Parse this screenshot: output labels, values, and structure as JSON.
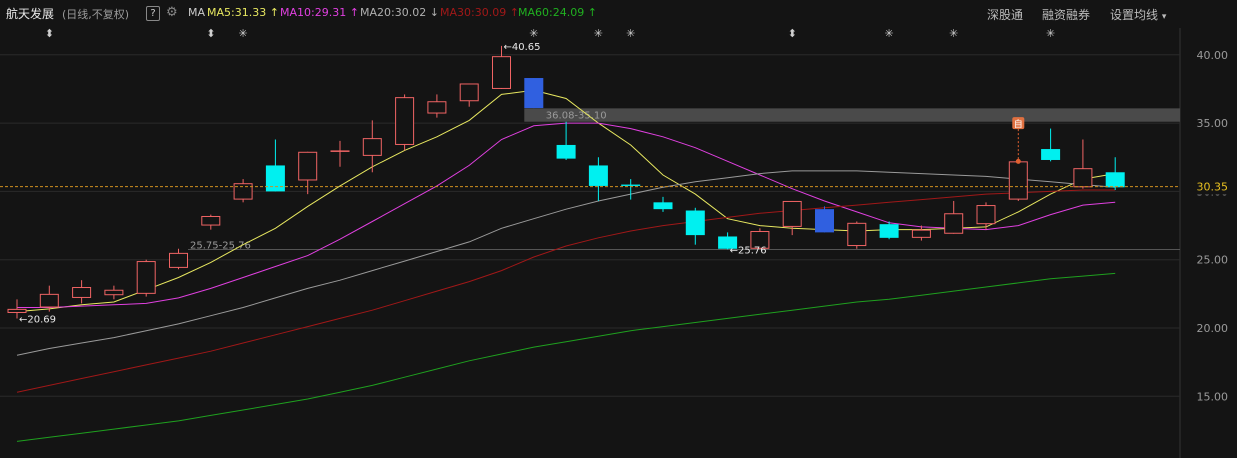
{
  "header": {
    "title": "航天发展",
    "period": "(日线,不复权)",
    "help": "?",
    "ma_label": "MA",
    "ma": [
      {
        "text": "MA5:31.33",
        "arrow": "↑",
        "color": "#e8e860"
      },
      {
        "text": "MA10:29.31",
        "arrow": "↑",
        "color": "#e040e0"
      },
      {
        "text": "MA20:30.02",
        "arrow": "↓",
        "color": "#b0b0b0"
      },
      {
        "text": "MA30:30.09",
        "arrow": "↑",
        "color": "#a01818"
      },
      {
        "text": "MA60:24.09",
        "arrow": "↑",
        "color": "#20b020"
      }
    ],
    "buttons": {
      "shengutong": "深股通",
      "rzrq": "融资融券",
      "set_ma": "设置均线"
    }
  },
  "chart_data": {
    "type": "candlestick",
    "y_ticks": [
      "40.00",
      "35.00",
      "30.00",
      "25.00",
      "20.00",
      "15.00"
    ],
    "ylim": [
      12.8,
      43.4
    ],
    "current_price": "30.35",
    "candles": [
      {
        "o": 21.1,
        "c": 21.4,
        "h": 22.1,
        "l": 20.7
      },
      {
        "o": 21.5,
        "c": 22.5,
        "h": 23.1,
        "l": 21.2
      },
      {
        "o": 22.2,
        "c": 23.0,
        "h": 23.5,
        "l": 21.8
      },
      {
        "o": 22.4,
        "c": 22.8,
        "h": 23.1,
        "l": 22.1
      },
      {
        "o": 22.5,
        "c": 24.9,
        "h": 25.0,
        "l": 22.3
      },
      {
        "o": 24.4,
        "c": 25.5,
        "h": 25.8,
        "l": 24.3
      },
      {
        "o": 27.5,
        "c": 28.2,
        "h": 28.3,
        "l": 27.2
      },
      {
        "o": 29.4,
        "c": 30.6,
        "h": 30.9,
        "l": 29.2
      },
      {
        "o": 31.9,
        "c": 30.0,
        "h": 33.8,
        "l": 30.0
      },
      {
        "o": 30.8,
        "c": 32.9,
        "h": 32.9,
        "l": 29.8
      },
      {
        "o": 32.9,
        "c": 33.0,
        "h": 33.7,
        "l": 31.8
      },
      {
        "o": 32.6,
        "c": 33.9,
        "h": 35.2,
        "l": 31.4
      },
      {
        "o": 33.4,
        "c": 36.9,
        "h": 37.1,
        "l": 33.0
      },
      {
        "o": 35.7,
        "c": 36.6,
        "h": 37.1,
        "l": 35.4
      },
      {
        "o": 36.6,
        "c": 37.9,
        "h": 37.9,
        "l": 36.2
      },
      {
        "o": 37.5,
        "c": 39.9,
        "h": 40.65,
        "l": 37.5
      },
      {
        "o": 38.3,
        "c": 36.1,
        "h": 38.3,
        "l": 36.1,
        "special": true
      },
      {
        "o": 33.4,
        "c": 32.4,
        "h": 35.1,
        "l": 32.3
      },
      {
        "o": 31.9,
        "c": 30.4,
        "h": 32.5,
        "l": 29.3
      },
      {
        "o": 30.5,
        "c": 30.4,
        "h": 30.9,
        "l": 29.4
      },
      {
        "o": 29.2,
        "c": 28.7,
        "h": 29.6,
        "l": 28.5
      },
      {
        "o": 28.6,
        "c": 26.8,
        "h": 28.8,
        "l": 26.1
      },
      {
        "o": 26.7,
        "c": 25.8,
        "h": 27.0,
        "l": 25.76
      },
      {
        "o": 25.8,
        "c": 27.1,
        "h": 27.3,
        "l": 25.8
      },
      {
        "o": 27.4,
        "c": 29.3,
        "h": 29.3,
        "l": 26.8
      },
      {
        "o": 28.7,
        "c": 27.0,
        "h": 28.9,
        "l": 27.0,
        "special": true
      },
      {
        "o": 26.0,
        "c": 27.7,
        "h": 27.8,
        "l": 25.8
      },
      {
        "o": 27.6,
        "c": 26.6,
        "h": 27.8,
        "l": 26.5
      },
      {
        "o": 26.6,
        "c": 27.2,
        "h": 27.5,
        "l": 26.4
      },
      {
        "o": 26.9,
        "c": 28.4,
        "h": 29.3,
        "l": 26.9
      },
      {
        "o": 27.6,
        "c": 29.0,
        "h": 29.2,
        "l": 27.2
      },
      {
        "o": 29.4,
        "c": 32.2,
        "h": 32.3,
        "l": 29.3
      },
      {
        "o": 33.1,
        "c": 32.3,
        "h": 34.6,
        "l": 32.2
      },
      {
        "o": 30.3,
        "c": 31.7,
        "h": 33.8,
        "l": 30.2
      },
      {
        "o": 31.4,
        "c": 30.3,
        "h": 32.5,
        "l": 30.1
      }
    ],
    "ma_lines": [
      {
        "name": "MA5",
        "color": "#e8e860",
        "values": [
          21.2,
          21.4,
          21.7,
          21.9,
          22.8,
          23.7,
          24.8,
          26.1,
          27.3,
          28.9,
          30.4,
          31.8,
          33.0,
          34.0,
          35.2,
          37.1,
          37.4,
          36.8,
          35.0,
          33.4,
          31.2,
          29.8,
          28.0,
          27.5,
          27.3,
          27.2,
          27.1,
          27.2,
          27.2,
          27.3,
          27.4,
          28.5,
          29.8,
          30.9,
          31.3
        ]
      },
      {
        "name": "MA10",
        "color": "#e040e0",
        "values": [
          21.5,
          21.5,
          21.6,
          21.7,
          21.8,
          22.2,
          22.9,
          23.7,
          24.5,
          25.3,
          26.5,
          27.8,
          29.1,
          30.4,
          31.9,
          33.8,
          34.8,
          35.0,
          35.0,
          34.6,
          34.0,
          33.2,
          32.2,
          31.2,
          30.2,
          29.3,
          28.5,
          27.7,
          27.4,
          27.3,
          27.2,
          27.5,
          28.3,
          29.0,
          29.2
        ]
      },
      {
        "name": "MA20",
        "color": "#9a9a9a",
        "values": [
          18.0,
          18.5,
          18.9,
          19.3,
          19.8,
          20.3,
          20.9,
          21.5,
          22.2,
          22.9,
          23.5,
          24.2,
          24.9,
          25.6,
          26.3,
          27.3,
          28.0,
          28.7,
          29.3,
          29.8,
          30.3,
          30.7,
          31.0,
          31.3,
          31.5,
          31.5,
          31.5,
          31.4,
          31.3,
          31.2,
          31.1,
          30.9,
          30.7,
          30.5,
          30.3
        ]
      },
      {
        "name": "MA30",
        "color": "#a01818",
        "values": [
          15.3,
          15.8,
          16.3,
          16.8,
          17.3,
          17.8,
          18.3,
          18.9,
          19.5,
          20.1,
          20.7,
          21.3,
          22.0,
          22.7,
          23.4,
          24.2,
          25.2,
          26.0,
          26.6,
          27.1,
          27.5,
          27.8,
          28.1,
          28.4,
          28.6,
          28.8,
          29.0,
          29.2,
          29.4,
          29.6,
          29.8,
          29.9,
          30.0,
          30.1,
          30.1
        ]
      },
      {
        "name": "MA60",
        "color": "#1fa01f",
        "values": [
          11.7,
          12.0,
          12.3,
          12.6,
          12.9,
          13.2,
          13.6,
          14.0,
          14.4,
          14.8,
          15.3,
          15.8,
          16.4,
          17.0,
          17.6,
          18.1,
          18.6,
          19.0,
          19.4,
          19.8,
          20.1,
          20.4,
          20.7,
          21.0,
          21.3,
          21.6,
          21.9,
          22.1,
          22.4,
          22.7,
          23.0,
          23.3,
          23.6,
          23.8,
          24.0
        ]
      }
    ],
    "annotations": {
      "low_label": "20.69",
      "high_label": "40.65",
      "low2_label": "25.76",
      "gap_upper_label": "36.08-35.10",
      "gap_upper": [
        35.1,
        36.08
      ],
      "gap_lower_label": "25.75-25.76",
      "gap_lower": 25.75,
      "marker_label": "自"
    },
    "top_markers": [
      {
        "idx": 1,
        "sym": "⬍"
      },
      {
        "idx": 6,
        "sym": "⬍"
      },
      {
        "idx": 7,
        "sym": "✳"
      },
      {
        "idx": 16,
        "sym": "✳"
      },
      {
        "idx": 18,
        "sym": "✳"
      },
      {
        "idx": 19,
        "sym": "✳"
      },
      {
        "idx": 24,
        "sym": "⬍"
      },
      {
        "idx": 27,
        "sym": "✳"
      },
      {
        "idx": 29,
        "sym": "✳"
      },
      {
        "idx": 32,
        "sym": "✳"
      }
    ],
    "colors": {
      "up": "#f06464",
      "down": "#00f0f0",
      "special": "#3060e0",
      "grid": "#2a2a2a",
      "axis_text": "#9a9a9a",
      "price_line": "#d09020"
    }
  }
}
